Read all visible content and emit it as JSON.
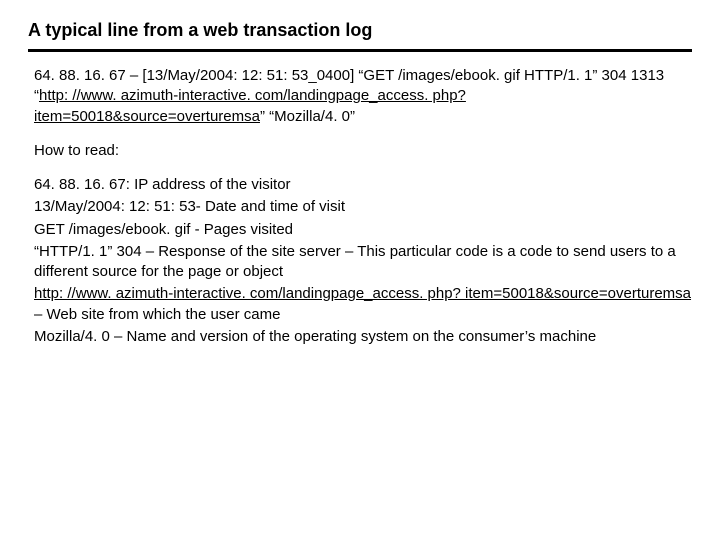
{
  "title": "A typical line from a web transaction log",
  "log": {
    "pre_link": " 64. 88. 16. 67 – [13/May/2004: 12: 51: 53_0400] “GET /images/ebook. gif HTTP/1. 1” 304 1313 “",
    "link": "http: //www. azimuth-interactive. com/landingpage_access. php? item=50018&source=overturemsa",
    "post_link": "” “Mozilla/4. 0”"
  },
  "how_label": " How to read:",
  "explain": {
    "l1": " 64. 88. 16. 67: IP address of the visitor",
    "l2": " 13/May/2004: 12: 51: 53-     Date and time of visit",
    "l3": " GET /images/ebook. gif     - Pages visited",
    "l4": " “HTTP/1. 1” 304 – Response of the site server – This particular code is a code to send users to a different source for the page or object",
    "l5_link": " http: //www. azimuth-interactive. com/landingpage_access. php? item=50018&source=overturemsa",
    "l5_post": " – Web site from which the user came",
    "l6": " Mozilla/4. 0 – Name and version of the operating system on the consumer’s machine"
  }
}
